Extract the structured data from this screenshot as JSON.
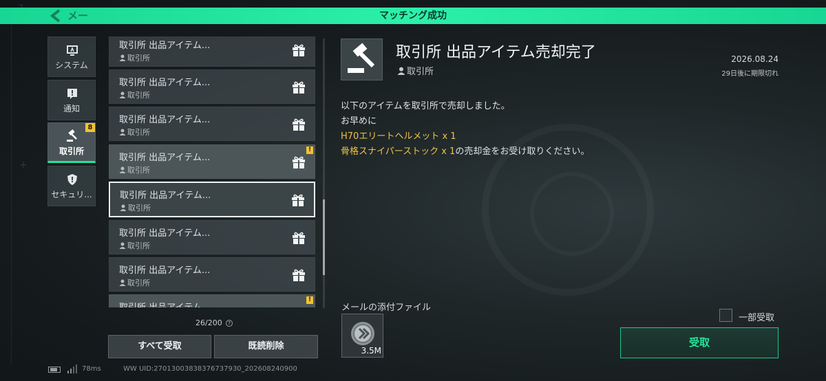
{
  "header": {
    "back_label": "メー",
    "banner_title": "マッチング成功"
  },
  "categories": [
    {
      "label": "システム",
      "icon": "monitor-icon"
    },
    {
      "label": "通知",
      "icon": "exclamation-icon"
    },
    {
      "label": "取引所",
      "icon": "gavel-icon",
      "badge": "8",
      "active": true
    },
    {
      "label": "セキュリ...",
      "icon": "shield-icon"
    }
  ],
  "mails": [
    {
      "title": "取引所 出品アイテム...",
      "sender": "取引所"
    },
    {
      "title": "取引所 出品アイテム...",
      "sender": "取引所"
    },
    {
      "title": "取引所 出品アイテム...",
      "sender": "取引所"
    },
    {
      "title": "取引所 出品アイテム...",
      "sender": "取引所",
      "flag": "!"
    },
    {
      "title": "取引所 出品アイテム...",
      "sender": "取引所"
    },
    {
      "title": "取引所 出品アイテム...",
      "sender": "取引所"
    },
    {
      "title": "取引所 出品アイテム...",
      "sender": "取引所"
    },
    {
      "title": "取引所 出品アイテム...",
      "sender": "",
      "flag": "!"
    }
  ],
  "list_count": "26/200",
  "buttons": {
    "receive_all": "すべて受取",
    "delete_read": "既読削除",
    "receive": "受取"
  },
  "detail": {
    "title": "取引所 出品アイテム売却完了",
    "sender": "取引所",
    "date": "2026.08.24",
    "expire": "29日後に期限切れ",
    "line1": "以下のアイテムを取引所で売却しました。",
    "line2": "お早めに",
    "item1": "H70エリートヘルメット x 1",
    "item2": "骨格スナイパーストック x 1",
    "line3_suffix": "の売却金をお受け取りください。"
  },
  "attachments": {
    "label": "メールの添付ファイル",
    "item_qty": "3.5M"
  },
  "partial_receive_label": "一部受取",
  "footer": {
    "ping": "78ms",
    "uid": "WW UID:27013003838376737930_202608240900"
  },
  "colors": {
    "accent": "#22e39c",
    "highlight": "#f0c24a",
    "badge": "#f2c230"
  }
}
